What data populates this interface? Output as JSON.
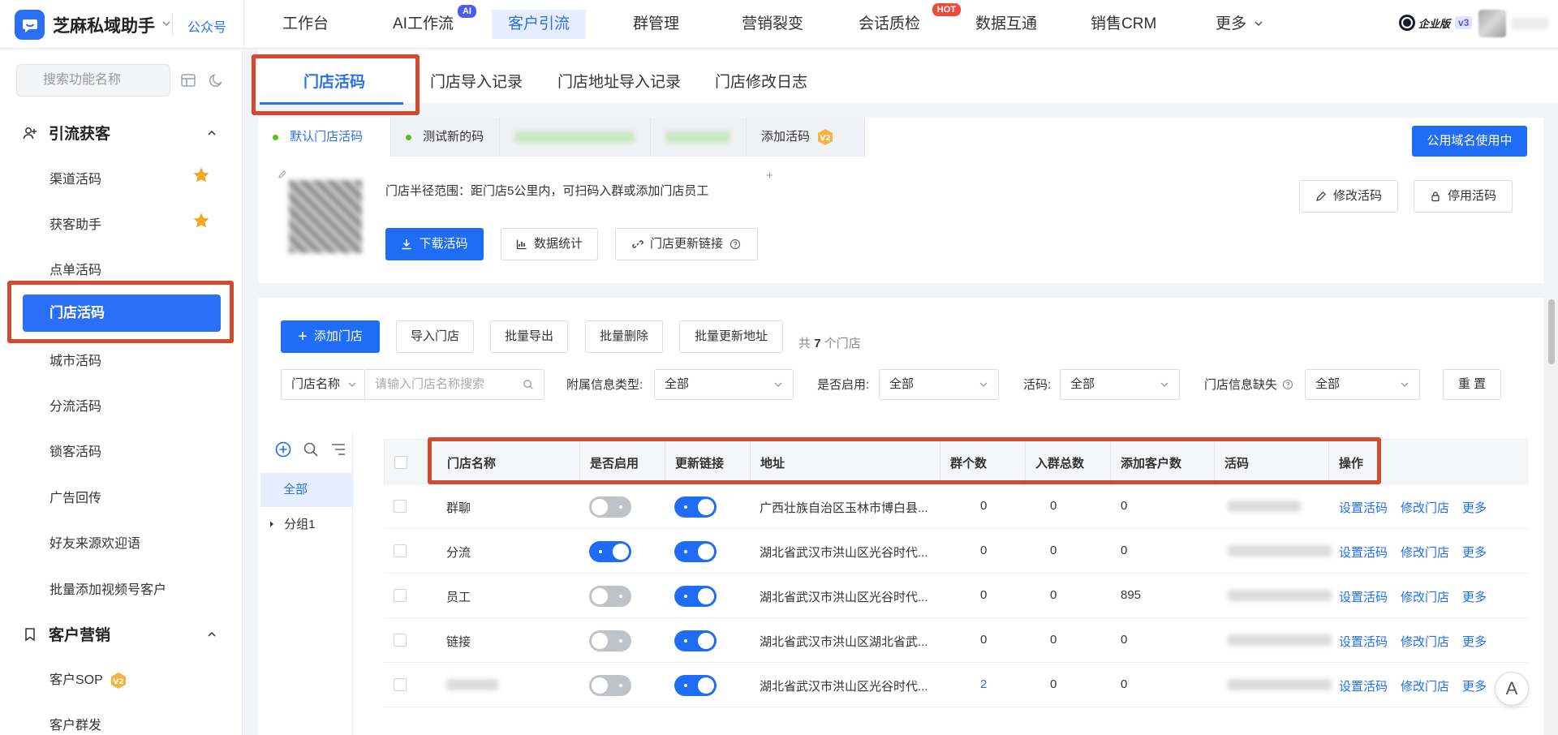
{
  "app": {
    "name": "芝麻私域助手",
    "gzh": "公众号"
  },
  "nav": {
    "items": [
      "工作台",
      "AI工作流",
      "客户引流",
      "群管理",
      "营销裂变",
      "会话质检",
      "数据互通",
      "销售CRM",
      "更多"
    ],
    "active": "客户引流",
    "badge_ai": "AI",
    "badge_hot": "HOT",
    "enterprise": "企业版",
    "version": "v3"
  },
  "sidebar": {
    "search_placeholder": "搜索功能名称",
    "groups": [
      {
        "label": "引流获客",
        "items": [
          "渠道活码",
          "获客助手",
          "点单活码",
          "门店活码",
          "城市活码",
          "分流活码",
          "锁客活码",
          "广告回传",
          "好友来源欢迎语",
          "批量添加视频号客户"
        ]
      },
      {
        "label": "客户营销",
        "items": [
          "客户SOP",
          "客户群发"
        ]
      }
    ],
    "active_item": "门店活码",
    "starred": [
      "渠道活码",
      "获客助手"
    ],
    "v2_badge": "V2"
  },
  "tabs": [
    "门店活码",
    "门店导入记录",
    "门店地址导入记录",
    "门店修改日志"
  ],
  "active_tab": "门店活码",
  "code_tabs": {
    "items": [
      "默认门店活码",
      "测试新的码"
    ],
    "add_label": "添加活码",
    "add_badge": "V2",
    "public_domain": "公用域名使用中"
  },
  "code_card": {
    "scope": "门店半径范围：距门店5公里内，可扫码入群或添加门店员工",
    "download": "下载活码",
    "stats": "数据统计",
    "update_link": "门店更新链接",
    "modify": "修改活码",
    "disable": "停用活码"
  },
  "toolbar": {
    "add_store": "添加门店",
    "import": "导入门店",
    "export": "批量导出",
    "delete": "批量删除",
    "update_addr": "批量更新地址",
    "total_prefix": "共",
    "total_count": "7",
    "total_suffix": "个门店"
  },
  "filters": {
    "name_field": "门店名称",
    "name_placeholder": "请输入门店名称搜索",
    "attach_label": "附属信息类型:",
    "attach_value": "全部",
    "enabled_label": "是否启用:",
    "enabled_value": "全部",
    "code_label": "活码:",
    "code_value": "全部",
    "missing_label": "门店信息缺失",
    "missing_value": "全部",
    "reset": "重 置"
  },
  "tree": {
    "all": "全部",
    "group1": "分组1"
  },
  "table": {
    "columns": [
      "门店名称",
      "是否启用",
      "更新链接",
      "地址",
      "群个数",
      "入群总数",
      "添加客户数",
      "活码",
      "操作"
    ],
    "rows": [
      {
        "name": "群聊",
        "enabled": false,
        "update": true,
        "address": "广西壮族自治区玉林市博白县...",
        "groups": "0",
        "joined": "0",
        "added": "0"
      },
      {
        "name": "分流",
        "enabled": true,
        "update": true,
        "address": "湖北省武汉市洪山区光谷时代...",
        "groups": "0",
        "joined": "0",
        "added": "0"
      },
      {
        "name": "员工",
        "enabled": false,
        "update": true,
        "address": "湖北省武汉市洪山区光谷时代...",
        "groups": "0",
        "joined": "0",
        "added": "895"
      },
      {
        "name": "链接",
        "enabled": false,
        "update": true,
        "address": "湖北省武汉市洪山区湖北省武...",
        "groups": "0",
        "joined": "0",
        "added": "0"
      },
      {
        "name": "",
        "enabled": false,
        "update": true,
        "address": "湖北省武汉市洪山区光谷时代...",
        "groups": "2",
        "joined": "0",
        "added": "0"
      }
    ],
    "ops": [
      "设置活码",
      "修改门店",
      "更多"
    ]
  },
  "float_label": "A",
  "colors": {
    "primary": "#1f6cf7",
    "highlight": "#d44a2f",
    "switch_off": "#bfc2c7"
  }
}
